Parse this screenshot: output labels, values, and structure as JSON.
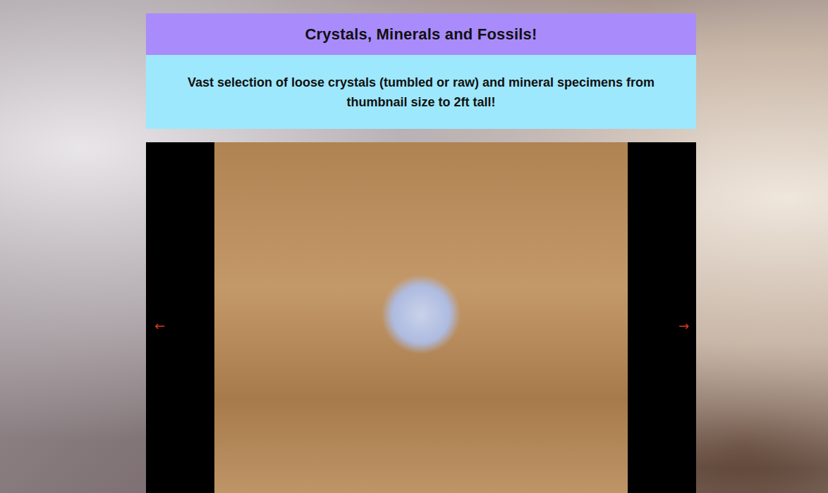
{
  "header": {
    "title": "Crystals, Minerals and Fossils!"
  },
  "intro": {
    "text": "Vast selection of loose crystals (tumbled or raw) and mineral specimens from thumbnail size to 2ft tall!"
  },
  "slideshow": {
    "prev": "←",
    "next": "→"
  }
}
